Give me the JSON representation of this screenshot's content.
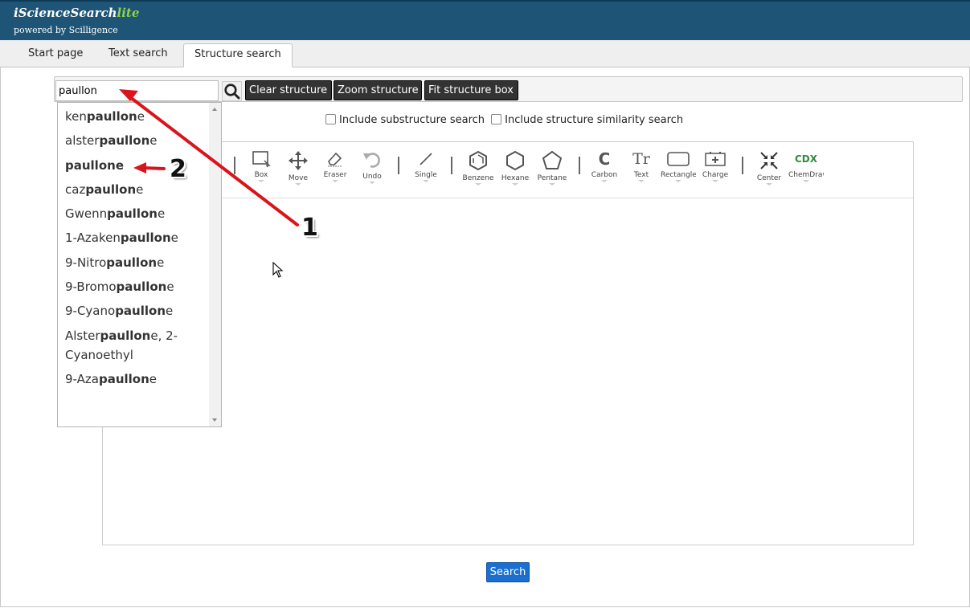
{
  "app": {
    "brand_main": "iScienceSearch",
    "brand_lite": "lite",
    "powered_by": "powered by Scilligence"
  },
  "tabs": [
    {
      "label": "Start page",
      "active": false
    },
    {
      "label": "Text search",
      "active": false
    },
    {
      "label": "Structure search",
      "active": true
    }
  ],
  "search": {
    "value": "paullon"
  },
  "buttons": {
    "clear": "Clear structure",
    "zoom": "Zoom structure",
    "fit": "Fit structure box",
    "search": "Search"
  },
  "options": {
    "substructure": "Include substructure search",
    "similarity": "Include structure similarity search"
  },
  "tools": {
    "box": "Box",
    "move": "Move",
    "eraser": "Eraser",
    "undo": "Undo",
    "single": "Single",
    "benzene": "Benzene",
    "hexane": "Hexane",
    "pentane": "Pentane",
    "carbon": "Carbon",
    "text": "Text",
    "rectangle": "Rectangle",
    "charge": "Charge",
    "center": "Center",
    "chemdraw": "ChemDraw",
    "cdx_glyph": "CDX",
    "carbon_glyph": "C",
    "text_glyph": "Tr"
  },
  "suggestions": [
    {
      "pre": "ken",
      "match": "paullon",
      "post": "e"
    },
    {
      "pre": "alster",
      "match": "paullon",
      "post": "e"
    },
    {
      "pre": "",
      "match": "paullon",
      "post": "e"
    },
    {
      "pre": "caz",
      "match": "paullon",
      "post": "e"
    },
    {
      "pre": "Gwenn",
      "match": "paullon",
      "post": "e"
    },
    {
      "pre": "1-Azaken",
      "match": "paullon",
      "post": "e"
    },
    {
      "pre": "9-Nitro",
      "match": "paullon",
      "post": "e"
    },
    {
      "pre": "9-Bromo",
      "match": "paullon",
      "post": "e"
    },
    {
      "pre": "9-Cyano",
      "match": "paullon",
      "post": "e"
    },
    {
      "pre": "Alster",
      "match": "paullon",
      "post": "e, 2-Cyanoethyl"
    },
    {
      "pre": "9-Aza",
      "match": "paullon",
      "post": "e"
    }
  ],
  "annotations": {
    "one": "1",
    "two": "2",
    "color": "#d9141b"
  }
}
